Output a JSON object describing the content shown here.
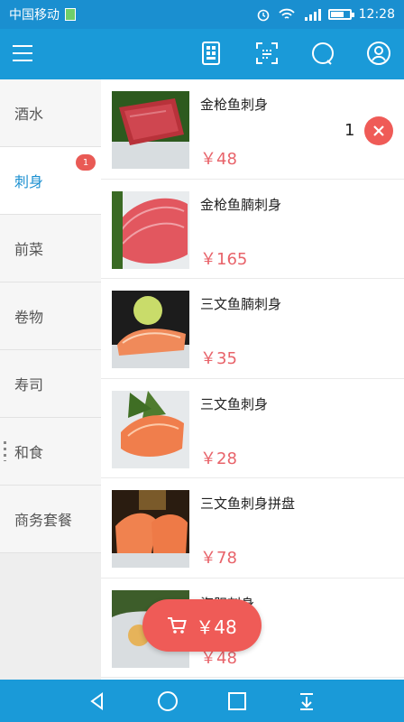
{
  "status_bar": {
    "carrier": "中国移动",
    "time": "12:28"
  },
  "header": {
    "icons": [
      "menu-icon",
      "receipt-icon",
      "scan-icon",
      "search-icon",
      "profile-icon"
    ]
  },
  "sidebar": {
    "items": [
      {
        "label": "酒水"
      },
      {
        "label": "刺身",
        "active": true,
        "badge": "1"
      },
      {
        "label": "前菜"
      },
      {
        "label": "卷物"
      },
      {
        "label": "寿司"
      },
      {
        "label": "和食"
      },
      {
        "label": "商务套餐"
      }
    ]
  },
  "products": [
    {
      "name": "金枪鱼刺身",
      "price": "￥48",
      "quantity": "1"
    },
    {
      "name": "金枪鱼腩刺身",
      "price": "￥165"
    },
    {
      "name": "三文鱼腩刺身",
      "price": "￥35"
    },
    {
      "name": "三文鱼刺身",
      "price": "￥28"
    },
    {
      "name": "三文鱼刺身拼盘",
      "price": "￥78"
    },
    {
      "name": "海胆刺身",
      "price": "￥48"
    }
  ],
  "cart": {
    "total": "￥48"
  },
  "colors": {
    "primary": "#1a9ad8",
    "accent": "#ef5b57",
    "price": "#e8636a"
  }
}
